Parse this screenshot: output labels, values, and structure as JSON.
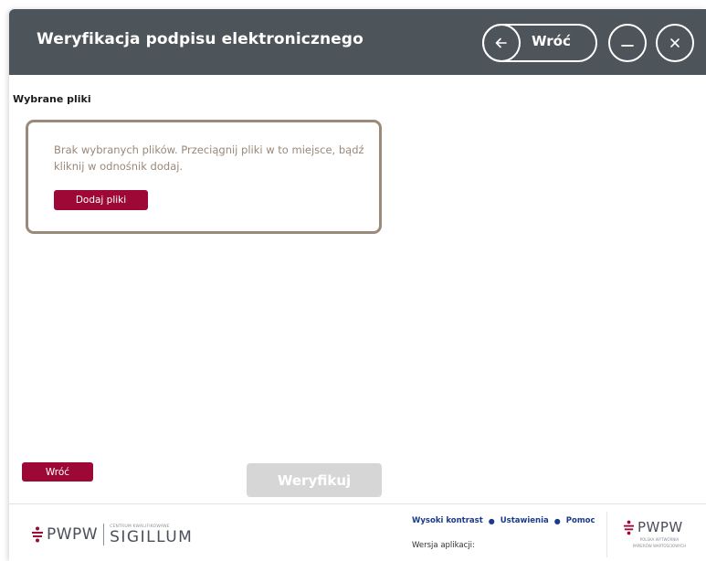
{
  "header": {
    "title": "Weryfikacja podpisu elektronicznego",
    "back_label": "Wróć"
  },
  "main": {
    "section_label": "Wybrane pliki",
    "drop_text": "Brak wybranych plików. Przeciągnij pliki w to miejsce, bądź kliknij w odnośnik dodaj.",
    "add_files_label": "Dodaj pliki",
    "back_button_label": "Wróć",
    "verify_button_label": "Weryfikuj"
  },
  "footer": {
    "links": [
      "Wysoki kontrast",
      "Ustawienia",
      "Pomoc"
    ],
    "version_label": "Wersja aplikacji:",
    "logo_left_brand": "PWPW",
    "logo_left_small": "CENTRUM KWALIFIKOWANE",
    "logo_left_product": "SIGILLUM",
    "logo_right_brand": "PWPW",
    "logo_right_small_1": "POLSKA WYTWÓRNIA",
    "logo_right_small_2": "PAPIERÓW WARTOŚCIOWYCH"
  },
  "colors": {
    "header_bg": "#4d545a",
    "accent": "#9e0836",
    "drop_border": "#9a8a7a",
    "link": "#1a3a8c",
    "disabled": "#d6d6d6"
  },
  "icons": [
    "arrow-left-icon",
    "minimize-icon",
    "close-icon",
    "pwpw-logo-icon"
  ]
}
